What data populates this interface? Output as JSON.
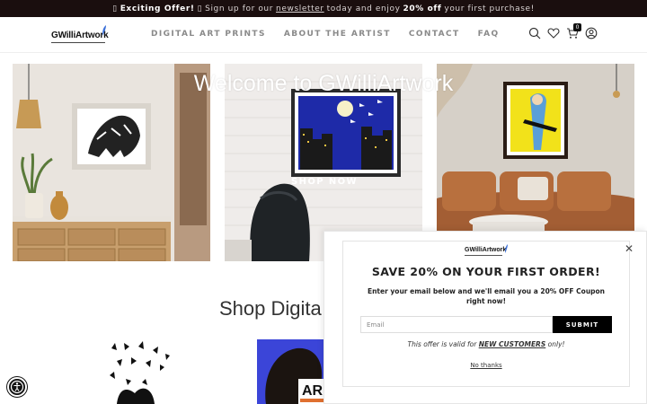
{
  "announcement": {
    "icon": "gift-icon",
    "exciting": "Exciting Offer!",
    "text_before": "Sign up for our",
    "link": "newsletter",
    "text_middle": "today and enjoy",
    "bold": "20% off",
    "text_after": "your first purchase!"
  },
  "header": {
    "logo": "GWilliArtwork",
    "nav": [
      "DIGITAL ART PRINTS",
      "ABOUT THE ARTIST",
      "CONTACT",
      "FAQ"
    ],
    "cart_count": "0"
  },
  "hero": {
    "title": "Welcome to GWilliArtwork",
    "button": "SHOP NOW"
  },
  "shop": {
    "title": "Shop Digita"
  },
  "popup": {
    "logo": "GWilliArtwork",
    "close": "✕",
    "headline": "SAVE 20% ON YOUR FIRST ORDER!",
    "subtext": "Enter your email below and we'll email you a 20% OFF Coupon right now!",
    "email_placeholder": "Email",
    "submit": "SUBMIT",
    "offer_before": "This offer is valid for",
    "offer_bold": "NEW CUSTOMERS",
    "offer_after": "only!",
    "no_thanks": "No thanks"
  },
  "colors": {
    "announcement_bg": "#1a0e0e",
    "nav_text": "#8a8a8a",
    "submit_bg": "#000000"
  }
}
